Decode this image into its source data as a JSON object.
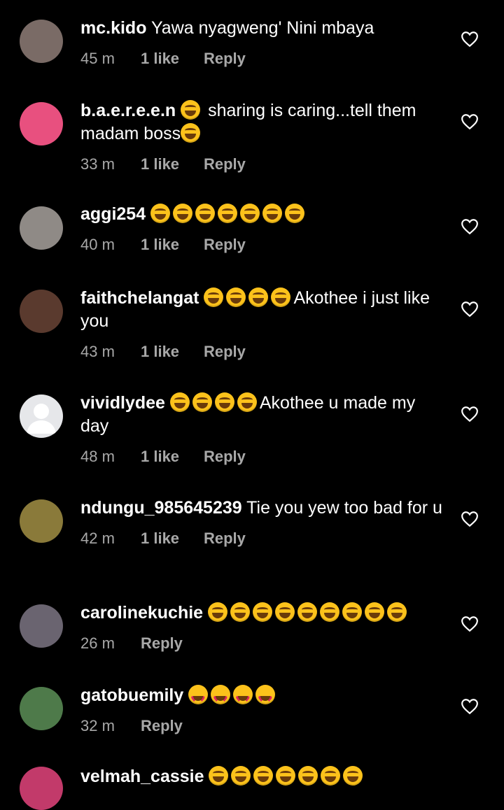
{
  "comments": [
    {
      "username": "mc.kido",
      "text": "Yawa nyagweng' Nini mbaya",
      "emoji_after": [],
      "time": "45 m",
      "likes": "1 like",
      "reply": "Reply",
      "avatar_color": "#7a6b66"
    },
    {
      "username": "b.a.e.r.e.e.n",
      "text_pre": "sharing is caring...tell them madam boss",
      "emoji_before": [
        "joy"
      ],
      "emoji_after": [
        "joy"
      ],
      "time": "33 m",
      "likes": "1 like",
      "reply": "Reply",
      "avatar_color": "#e8507f"
    },
    {
      "username": "aggi254",
      "emoji_count": 7,
      "time": "40 m",
      "likes": "1 like",
      "reply": "Reply",
      "avatar_color": "#8f8a86"
    },
    {
      "username": "faithchelangat",
      "text": "Akothee i just like you",
      "emoji_count": 4,
      "time": "43 m",
      "likes": "1 like",
      "reply": "Reply",
      "avatar_color": "#5a3a2e"
    },
    {
      "username": "vividlydee",
      "text": "Akothee u made my day",
      "emoji_count": 4,
      "time": "48 m",
      "likes": "1 like",
      "reply": "Reply",
      "avatar_color": "#e6e7ea"
    },
    {
      "username": "ndungu_985645239",
      "text": "Tie you yew too bad for u",
      "time": "42 m",
      "likes": "1 like",
      "reply": "Reply",
      "avatar_color": "#8a7a3a"
    },
    {
      "username": "carolinekuchie",
      "emoji_count": 9,
      "time": "26 m",
      "reply": "Reply",
      "avatar_color": "#6a6470"
    },
    {
      "username": "gatobuemily",
      "emoji_count": 4,
      "time": "32 m",
      "reply": "Reply",
      "avatar_color": "#4e7a4a"
    },
    {
      "username": "velmah_cassie",
      "emoji_count": 7,
      "avatar_color": "#c23a6a"
    }
  ]
}
